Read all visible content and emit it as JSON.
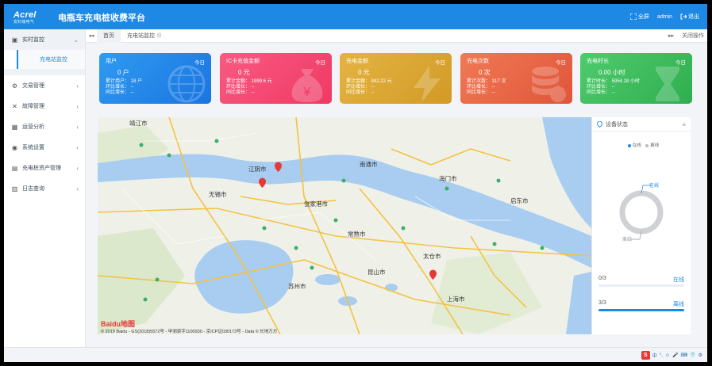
{
  "app": {
    "logo_text": "Acrel",
    "logo_sub": "安科瑞电气",
    "title": "电瓶车充电桩收费平台"
  },
  "topbar": {
    "fullscreen_label": "全屏",
    "user": "admin",
    "logout_label": "退出"
  },
  "sidebar": {
    "items": [
      {
        "label": "实时监控",
        "icon": "monitor-icon",
        "open": true
      },
      {
        "label": "交易管理",
        "icon": "transaction-icon"
      },
      {
        "label": "故障管理",
        "icon": "wrench-icon"
      },
      {
        "label": "运营分析",
        "icon": "analysis-icon"
      },
      {
        "label": "系统设置",
        "icon": "settings-icon"
      },
      {
        "label": "充电桩资产管理",
        "icon": "asset-icon"
      },
      {
        "label": "日志查询",
        "icon": "log-icon"
      }
    ],
    "sub_active": "充电站监控"
  },
  "tabs": {
    "home": "首页",
    "current": "充电站监控",
    "right_action": "关闭操作"
  },
  "cards": [
    {
      "title": "用户",
      "period": "今日",
      "value": "0 户",
      "lines": [
        "累计用户：  18 户",
        "环比增长：  --",
        "同比增长：  --"
      ],
      "color_from": "#2f9bf1",
      "color_to": "#1a74e0",
      "icon": "globe-icon"
    },
    {
      "title": "IC卡充值金额",
      "period": "今日",
      "value": "0 元",
      "lines": [
        "累计金额：  1999.6 元",
        "环比增长：  --",
        "同比增长：  --"
      ],
      "color_from": "#f85a83",
      "color_to": "#ef3a63",
      "icon": "money-bag-icon"
    },
    {
      "title": "充电金额",
      "period": "今日",
      "value": "0 元",
      "lines": [
        "累计金额：  842.22 元",
        "环比增长：  --",
        "同比增长：  --"
      ],
      "color_from": "#e4b442",
      "color_to": "#d29a27",
      "icon": "lightning-icon"
    },
    {
      "title": "充电次数",
      "period": "今日",
      "value": "0 次",
      "lines": [
        "累计次数：  317 次",
        "环比增长：  --",
        "同比增长：  --"
      ],
      "color_from": "#f07a55",
      "color_to": "#e0553a",
      "icon": "database-icon"
    },
    {
      "title": "充电时长",
      "period": "今日",
      "value": "0.00 小时",
      "lines": [
        "累计时长：  5954.28 小时",
        "环比增长：  --",
        "同比增长：  --"
      ],
      "color_from": "#4fcb6d",
      "color_to": "#2fae50",
      "icon": "hourglass-icon"
    }
  ],
  "map": {
    "copyright": "© 2019 Baidu - GS(2018)5572号 - 甲测资字1100930 - 京ICP证030173号 - Data © 长地万方",
    "logo": "Baidu地图",
    "labels": [
      {
        "text": "靖江市"
      },
      {
        "text": "江阴市"
      },
      {
        "text": "南通市"
      },
      {
        "text": "张家港市"
      },
      {
        "text": "常熟市"
      },
      {
        "text": "海门市"
      },
      {
        "text": "无锡市"
      },
      {
        "text": "苏州市"
      },
      {
        "text": "昆山市"
      },
      {
        "text": "上海市"
      },
      {
        "text": "太仓市"
      },
      {
        "text": "启东市"
      }
    ]
  },
  "status_panel": {
    "title": "设备状态",
    "legend": [
      {
        "label": "在线",
        "color": "#1e88e5"
      },
      {
        "label": "离线",
        "color": "#bdbdbd"
      }
    ],
    "donut_top_label": "在线",
    "donut_bottom_label": "离线",
    "online": {
      "label": "0/3",
      "status": "在线",
      "fraction": 0,
      "color": "#1e88e5"
    },
    "offline": {
      "label": "3/3",
      "status": "离线",
      "fraction": 1.0,
      "color": "#1e88e5"
    }
  },
  "bottombar": {
    "ime_icon": "S",
    "ime_items": [
      "中",
      "°,",
      "☺",
      "🎤",
      "⌨",
      "👕",
      "⚙"
    ]
  }
}
